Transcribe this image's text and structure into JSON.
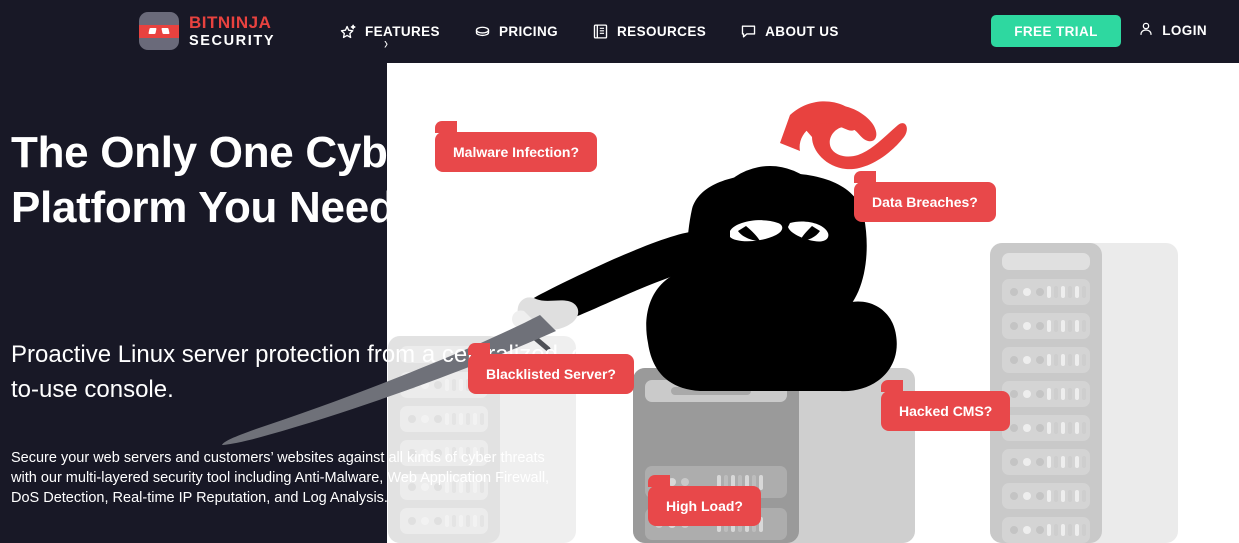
{
  "brand": {
    "name_top": "BITNINJA",
    "name_bottom": "SECURITY",
    "logo_icon": "ninja-mask-icon",
    "color_red": "#e8423f",
    "color_green": "#2ed8a0",
    "color_dark": "#181826"
  },
  "nav": {
    "items": [
      {
        "label": "FEATURES",
        "icon": "sparkle-star-icon",
        "has_dropdown": true,
        "caret": "›"
      },
      {
        "label": "PRICING",
        "icon": "coin-icon",
        "has_dropdown": false
      },
      {
        "label": "RESOURCES",
        "icon": "book-icon",
        "has_dropdown": false
      },
      {
        "label": "ABOUT US",
        "icon": "speech-bubble-icon",
        "has_dropdown": false
      }
    ],
    "cta_label": "FREE TRIAL",
    "login_label": "LOGIN",
    "login_icon": "user-icon"
  },
  "hero": {
    "headline": "The Only One Cybersecurity Platform You Need",
    "subheadline": "Proactive Linux server protection from a centralized, easy-to-use console.",
    "paragraph": "Secure your web servers and customers’ websites against all kinds of cyber threats with our multi-layered security tool including Anti-Malware, Web Application Firewall, DoS Detection, Real-time IP Reputation, and Log Analysis."
  },
  "badges": [
    {
      "label": "Malware Infection?",
      "name": "badge-malware-infection"
    },
    {
      "label": "Data Breaches?",
      "name": "badge-data-breaches"
    },
    {
      "label": "Blacklisted Server?",
      "name": "badge-blacklisted-server"
    },
    {
      "label": "Hacked CMS?",
      "name": "badge-hacked-cms"
    },
    {
      "label": "High Load?",
      "name": "badge-high-load"
    }
  ],
  "illustration": {
    "ninja_icon": "crouching-ninja-with-sword",
    "server_rack_icon": "server-rack-icon",
    "headband_color": "#e8423f",
    "ninja_color": "#000000",
    "sword_color": "#6f7179"
  }
}
